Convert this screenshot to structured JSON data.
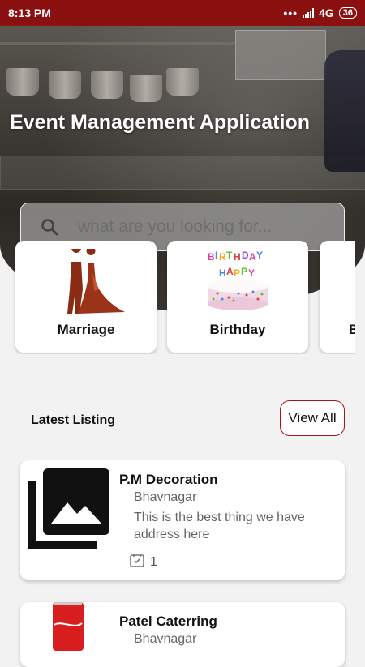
{
  "status_bar": {
    "time": "8:13 PM",
    "network": "4G",
    "battery": "36"
  },
  "hero": {
    "title": "Event Management Application",
    "search": {
      "placeholder": "what are you looking for...",
      "icon": "search-icon"
    }
  },
  "categories": [
    {
      "label": "Marriage",
      "icon": "wedding-couple-icon"
    },
    {
      "label": "Birthday",
      "icon": "birthday-cake-icon"
    },
    {
      "label": "B",
      "icon": "category-icon"
    }
  ],
  "latest": {
    "title": "Latest Listing",
    "view_all_label": "View All"
  },
  "listings": [
    {
      "name": "P.M Decoration",
      "city": "Bhavnagar",
      "description": "This is the best thing we have address here",
      "count": "1",
      "image": "image-placeholder-icon"
    },
    {
      "name": "Patel Caterring",
      "city": "Bhavnagar",
      "image": "coca-cola-can-image"
    }
  ],
  "colors": {
    "status_bar": "#8b1111",
    "accent_border": "#a11616",
    "background": "#f2f2f2"
  }
}
